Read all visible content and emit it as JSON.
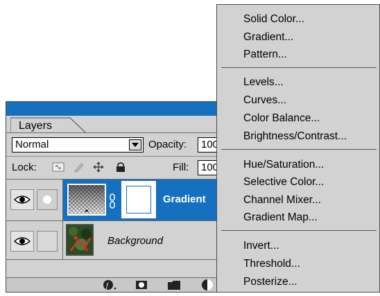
{
  "layers_panel": {
    "tab_label": "Layers",
    "blend_mode": "Normal",
    "opacity_label": "Opacity:",
    "opacity_value": "100",
    "lock_label": "Lock:",
    "fill_label": "Fill:",
    "fill_value": "100",
    "layers": [
      {
        "name": "Gradient",
        "selected": true
      },
      {
        "name": "Background",
        "selected": false
      }
    ]
  },
  "menu": {
    "groups": [
      [
        "Solid Color...",
        "Gradient...",
        "Pattern..."
      ],
      [
        "Levels...",
        "Curves...",
        "Color Balance...",
        "Brightness/Contrast..."
      ],
      [
        "Hue/Saturation...",
        "Selective Color...",
        "Channel Mixer...",
        "Gradient Map..."
      ],
      [
        "Invert...",
        "Threshold...",
        "Posterize..."
      ]
    ]
  },
  "colors": {
    "selection_blue": "#1570c0",
    "panel_gray": "#d2d2d2"
  },
  "icons": [
    "eye-icon",
    "link-chain-icon",
    "lock-transparency-icon",
    "lock-brush-icon",
    "lock-move-icon",
    "lock-all-icon",
    "layer-style-icon",
    "add-mask-icon",
    "new-set-icon",
    "adjustment-layer-icon",
    "dropdown-arrow-icon"
  ]
}
